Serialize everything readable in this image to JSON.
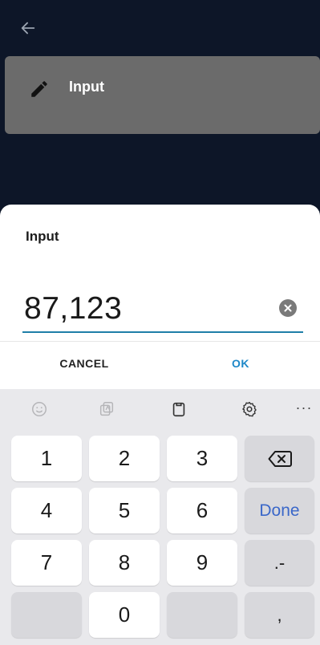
{
  "app": {
    "card_label": "Input"
  },
  "dialog": {
    "title": "Input",
    "value": "87,123",
    "cancel_label": "CANCEL",
    "ok_label": "OK"
  },
  "keyboard": {
    "keys": {
      "k1": "1",
      "k2": "2",
      "k3": "3",
      "k4": "4",
      "k5": "5",
      "k6": "6",
      "k7": "7",
      "k8": "8",
      "k9": "9",
      "k0": "0",
      "done": "Done",
      "dotminus": ".-",
      "comma": ","
    },
    "more_label": "···"
  },
  "colors": {
    "background": "#0d1628",
    "card": "#6b6b6b",
    "accent": "#1e88c8",
    "done": "#3a67c9"
  }
}
